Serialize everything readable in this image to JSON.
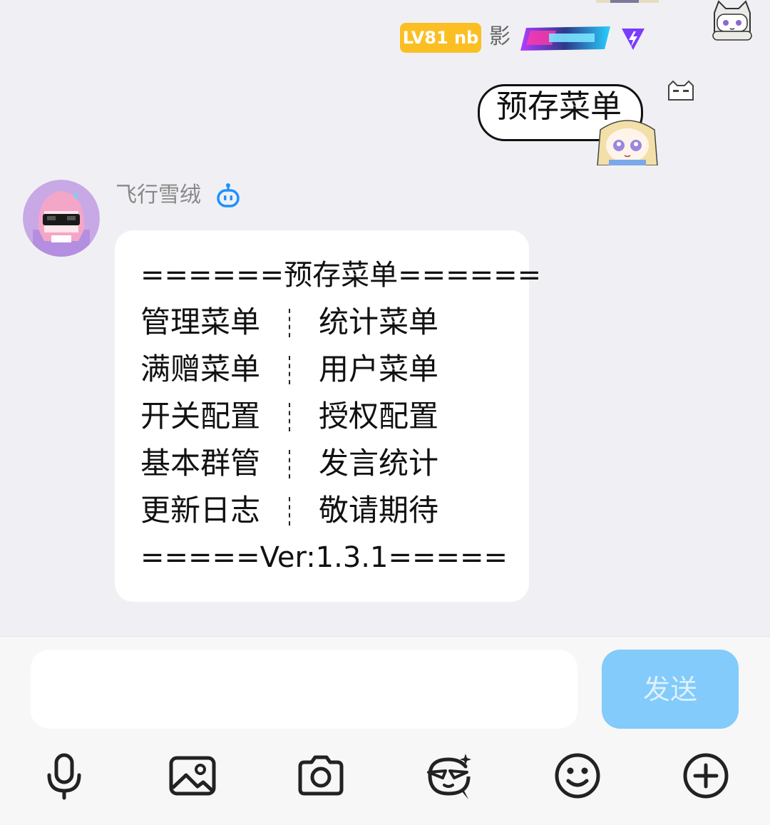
{
  "self_message": {
    "level_badge": "LV81 nb",
    "sender_name": "影",
    "sticker_text": "预存菜单"
  },
  "bot_message": {
    "sender_name": "飞行雪绒",
    "header_line": "======预存菜单======",
    "menu_rows": [
      {
        "left": "管理菜单",
        "right": "统计菜单"
      },
      {
        "left": "满赠菜单",
        "right": "用户菜单"
      },
      {
        "left": "开关配置",
        "right": "授权配置"
      },
      {
        "left": "基本群管",
        "right": "发言统计"
      },
      {
        "left": "更新日志",
        "right": "敬请期待"
      }
    ],
    "footer_line": "=====Ver:1.3.1====="
  },
  "composer": {
    "input_value": "",
    "send_label": "发送"
  },
  "toolbar": {
    "icons": [
      "microphone-icon",
      "image-icon",
      "camera-icon",
      "ai-face-icon",
      "emoji-icon",
      "plus-icon"
    ]
  },
  "colors": {
    "send_button": "#82cbfa",
    "level_badge": "#fbbf24",
    "chat_background": "#f0f0f4"
  }
}
